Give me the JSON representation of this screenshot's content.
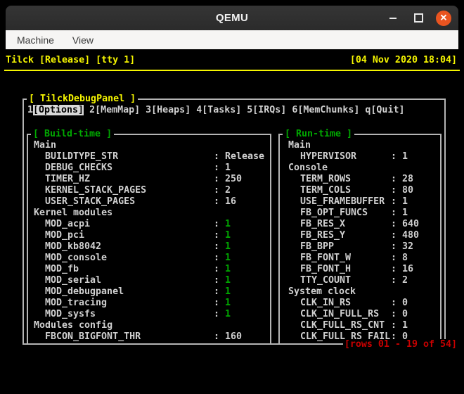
{
  "window": {
    "title": "QEMU"
  },
  "menu": {
    "items": [
      "Machine",
      "View"
    ]
  },
  "status_bar": {
    "left": "Tilck [Release] [tty 1]",
    "right": "[04 Nov 2020 18:04]"
  },
  "panel": {
    "title": "[ TilckDebugPanel ]",
    "tabs": [
      {
        "key": "1",
        "label": "[Options]",
        "name": "options",
        "active": true
      },
      {
        "key": "2",
        "label": "[MemMap]",
        "name": "memmap",
        "active": false
      },
      {
        "key": "3",
        "label": "[Heaps]",
        "name": "heaps",
        "active": false
      },
      {
        "key": "4",
        "label": "[Tasks]",
        "name": "tasks",
        "active": false
      },
      {
        "key": "5",
        "label": "[IRQs]",
        "name": "irqs",
        "active": false
      },
      {
        "key": "6",
        "label": "[MemChunks]",
        "name": "memchunks",
        "active": false
      },
      {
        "key": "q",
        "label": "[Quit]",
        "name": "quit",
        "active": false
      }
    ],
    "pager": "[rows 01 - 19 of 54]"
  },
  "build_time": {
    "title": "[ Build-time ]",
    "rows": [
      {
        "section": "Main"
      },
      {
        "label": "BUILDTYPE_STR",
        "value": "Release"
      },
      {
        "label": "DEBUG_CHECKS",
        "value": "1"
      },
      {
        "label": "TIMER_HZ",
        "value": "250"
      },
      {
        "label": "KERNEL_STACK_PAGES",
        "value": "2"
      },
      {
        "label": "USER_STACK_PAGES",
        "value": "16"
      },
      {
        "section": "Kernel modules"
      },
      {
        "label": "MOD_acpi",
        "value": "1",
        "green": true
      },
      {
        "label": "MOD_pci",
        "value": "1",
        "green": true
      },
      {
        "label": "MOD_kb8042",
        "value": "1",
        "green": true
      },
      {
        "label": "MOD_console",
        "value": "1",
        "green": true
      },
      {
        "label": "MOD_fb",
        "value": "1",
        "green": true
      },
      {
        "label": "MOD_serial",
        "value": "1",
        "green": true
      },
      {
        "label": "MOD_debugpanel",
        "value": "1",
        "green": true
      },
      {
        "label": "MOD_tracing",
        "value": "1",
        "green": true
      },
      {
        "label": "MOD_sysfs",
        "value": "1",
        "green": true
      },
      {
        "section": "Modules config"
      },
      {
        "label": "FBCON_BIGFONT_THR",
        "value": "160"
      }
    ]
  },
  "run_time": {
    "title": "[ Run-time ]",
    "rows": [
      {
        "section": "Main"
      },
      {
        "label": "HYPERVISOR",
        "value": "1"
      },
      {
        "section": "Console"
      },
      {
        "label": "TERM_ROWS",
        "value": "28"
      },
      {
        "label": "TERM_COLS",
        "value": "80"
      },
      {
        "label": "USE_FRAMEBUFFER",
        "value": "1"
      },
      {
        "label": "FB_OPT_FUNCS",
        "value": "1"
      },
      {
        "label": "FB_RES_X",
        "value": "640"
      },
      {
        "label": "FB_RES_Y",
        "value": "480"
      },
      {
        "label": "FB_BPP",
        "value": "32"
      },
      {
        "label": "FB_FONT_W",
        "value": "8"
      },
      {
        "label": "FB_FONT_H",
        "value": "16"
      },
      {
        "label": "TTY_COUNT",
        "value": "2"
      },
      {
        "section": "System clock"
      },
      {
        "label": "CLK_IN_RS",
        "value": "0"
      },
      {
        "label": "CLK_IN_FULL_RS",
        "value": "0"
      },
      {
        "label": "CLK_FULL_RS_CNT",
        "value": "1"
      },
      {
        "label": "CLK_FULL_RS_FAIL",
        "value": "0"
      }
    ]
  },
  "colors": {
    "terminal_yellow": "#f5f500",
    "terminal_green": "#00a800",
    "terminal_red": "#c80000",
    "terminal_white": "#d0d0d0",
    "box_border": "#b4b4b4",
    "titlebar_bg": "#2d2d2d",
    "menubar_bg": "#f6f5f4",
    "close_button": "#e95420"
  }
}
